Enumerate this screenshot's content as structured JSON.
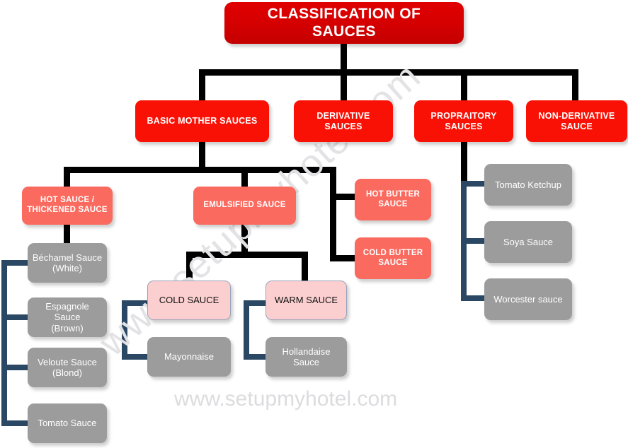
{
  "diagram": {
    "title": "CLASSIFICATION OF SAUCES",
    "watermark_diagonal": "www.setupmyhotel.com",
    "watermark_footer": "www.setupmyhotel.com",
    "colors": {
      "root_red": "#d60000",
      "level2_red": "#fa1105",
      "level3_salmon": "#fa6a5f",
      "level4_pink": "#fbcfcf",
      "leaf_gray": "#9c9c9c",
      "connector_black": "#000000",
      "connector_navy": "#2a4763",
      "background": "#ffffff"
    }
  },
  "nodes": {
    "root": {
      "label": "CLASSIFICATION OF SAUCES",
      "line1": "CLASSIFICATION OF",
      "line2": "SAUCES"
    },
    "level2": [
      {
        "id": "basic-mother-sauces",
        "label": "BASIC MOTHER SAUCES",
        "line1": "BASIC MOTHER SAUCES",
        "line2": ""
      },
      {
        "id": "derivative-sauces",
        "label": "DERIVATIVE SAUCES",
        "line1": "DERIVATIVE SAUCES",
        "line2": ""
      },
      {
        "id": "propraitory-sauces",
        "label": "PROPRAITORY SAUCES",
        "line1": "PROPRAITORY",
        "line2": "SAUCES"
      },
      {
        "id": "non-derivative-sauce",
        "label": "NON-DERIVATIVE SAUCE",
        "line1": "NON-DERIVATIVE",
        "line2": "SAUCE"
      }
    ],
    "level3": [
      {
        "id": "hot-thickened-sauce",
        "label": "HOT SAUCE / THICKENED SAUCE",
        "line1": "HOT SAUCE /",
        "line2": "THICKENED SAUCE"
      },
      {
        "id": "emulsified-sauce",
        "label": "EMULSIFIED SAUCE",
        "line1": "EMULSIFIED SAUCE",
        "line2": ""
      },
      {
        "id": "hot-butter-sauce",
        "label": "HOT BUTTER SAUCE",
        "line1": "HOT BUTTER",
        "line2": "SAUCE"
      },
      {
        "id": "cold-butter-sauce",
        "label": "COLD BUTTER SAUCE",
        "line1": "COLD BUTTER",
        "line2": "SAUCE"
      }
    ],
    "level4": [
      {
        "id": "cold-sauce",
        "label": "COLD SAUCE"
      },
      {
        "id": "warm-sauce",
        "label": "WARM SAUCE"
      }
    ],
    "mother_sauce_leaves": [
      {
        "id": "bechamel-sauce",
        "label": "Béchamel Sauce (White)",
        "line1": "Béchamel Sauce",
        "line2": "(White)"
      },
      {
        "id": "espagnole-sauce",
        "label": "Espagnole Sauce (Brown)",
        "line1": "Espagnole Sauce",
        "line2": "(Brown)"
      },
      {
        "id": "veloute-sauce",
        "label": "Veloute Sauce (Blond)",
        "line1": "Veloute Sauce",
        "line2": "(Blond)"
      },
      {
        "id": "tomato-sauce",
        "label": "Tomato Sauce",
        "line1": "Tomato Sauce",
        "line2": ""
      }
    ],
    "emulsified_leaves": [
      {
        "id": "mayonnaise",
        "label": "Mayonnaise"
      },
      {
        "id": "hollandaise-sauce",
        "label": "Hollandaise Sauce"
      }
    ],
    "propraitory_leaves": [
      {
        "id": "tomato-ketchup",
        "label": "Tomato Ketchup"
      },
      {
        "id": "soya-sauce",
        "label": "Soya Sauce"
      },
      {
        "id": "worcester-sauce",
        "label": "Worcester sauce"
      }
    ]
  }
}
